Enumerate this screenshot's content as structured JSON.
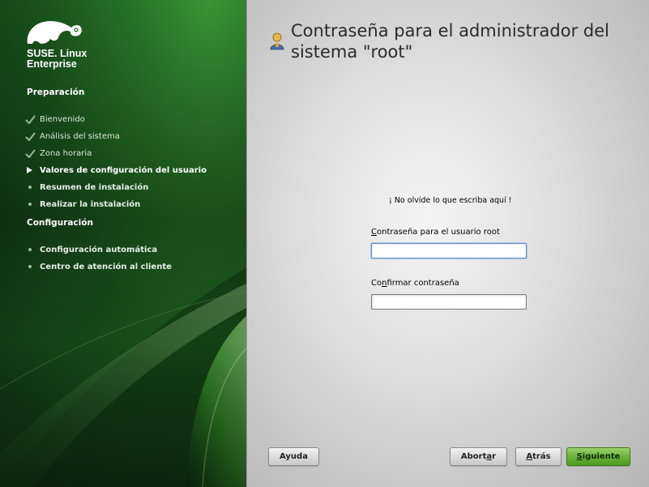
{
  "sidebar": {
    "brand_line1": "SUSE. Linux",
    "brand_line2": "Enterprise",
    "logo_icon": "suse-chameleon-icon",
    "sections": [
      {
        "title": "Preparación",
        "steps": [
          {
            "label": "Bienvenido",
            "state": "done"
          },
          {
            "label": "Análisis del sistema",
            "state": "done"
          },
          {
            "label": "Zona horaria",
            "state": "done"
          },
          {
            "label": "Valores de configuración del usuario",
            "state": "current"
          },
          {
            "label": "Resumen de instalación",
            "state": "todo"
          },
          {
            "label": "Realizar la instalación",
            "state": "todo"
          }
        ]
      },
      {
        "title": "Configuración",
        "steps": [
          {
            "label": "Configuración automática",
            "state": "todo"
          },
          {
            "label": "Centro de atención al cliente",
            "state": "todo"
          }
        ]
      }
    ]
  },
  "main": {
    "title": "Contraseña para el administrador del sistema \"root\"",
    "title_icon": "user-admin-icon",
    "hint": "¡ No olvide lo que escriba aquí !",
    "fields": [
      {
        "label_mnemonic": "C",
        "label_rest": "ontraseña para el usuario root",
        "value": "",
        "focused": true
      },
      {
        "label_pre": "Co",
        "label_mnemonic": "n",
        "label_rest": "firmar contraseña",
        "value": "",
        "focused": false
      }
    ]
  },
  "buttons": {
    "help": "Ayuda",
    "abort_pre": "Abort",
    "abort_mnemonic": "a",
    "abort_post": "r",
    "back_mnemonic": "A",
    "back_post": "trás",
    "next_mnemonic": "S",
    "next_post": "iguiente"
  },
  "colors": {
    "sidebar_green": "#1c5a1f",
    "primary_button": "#6bb33a"
  }
}
